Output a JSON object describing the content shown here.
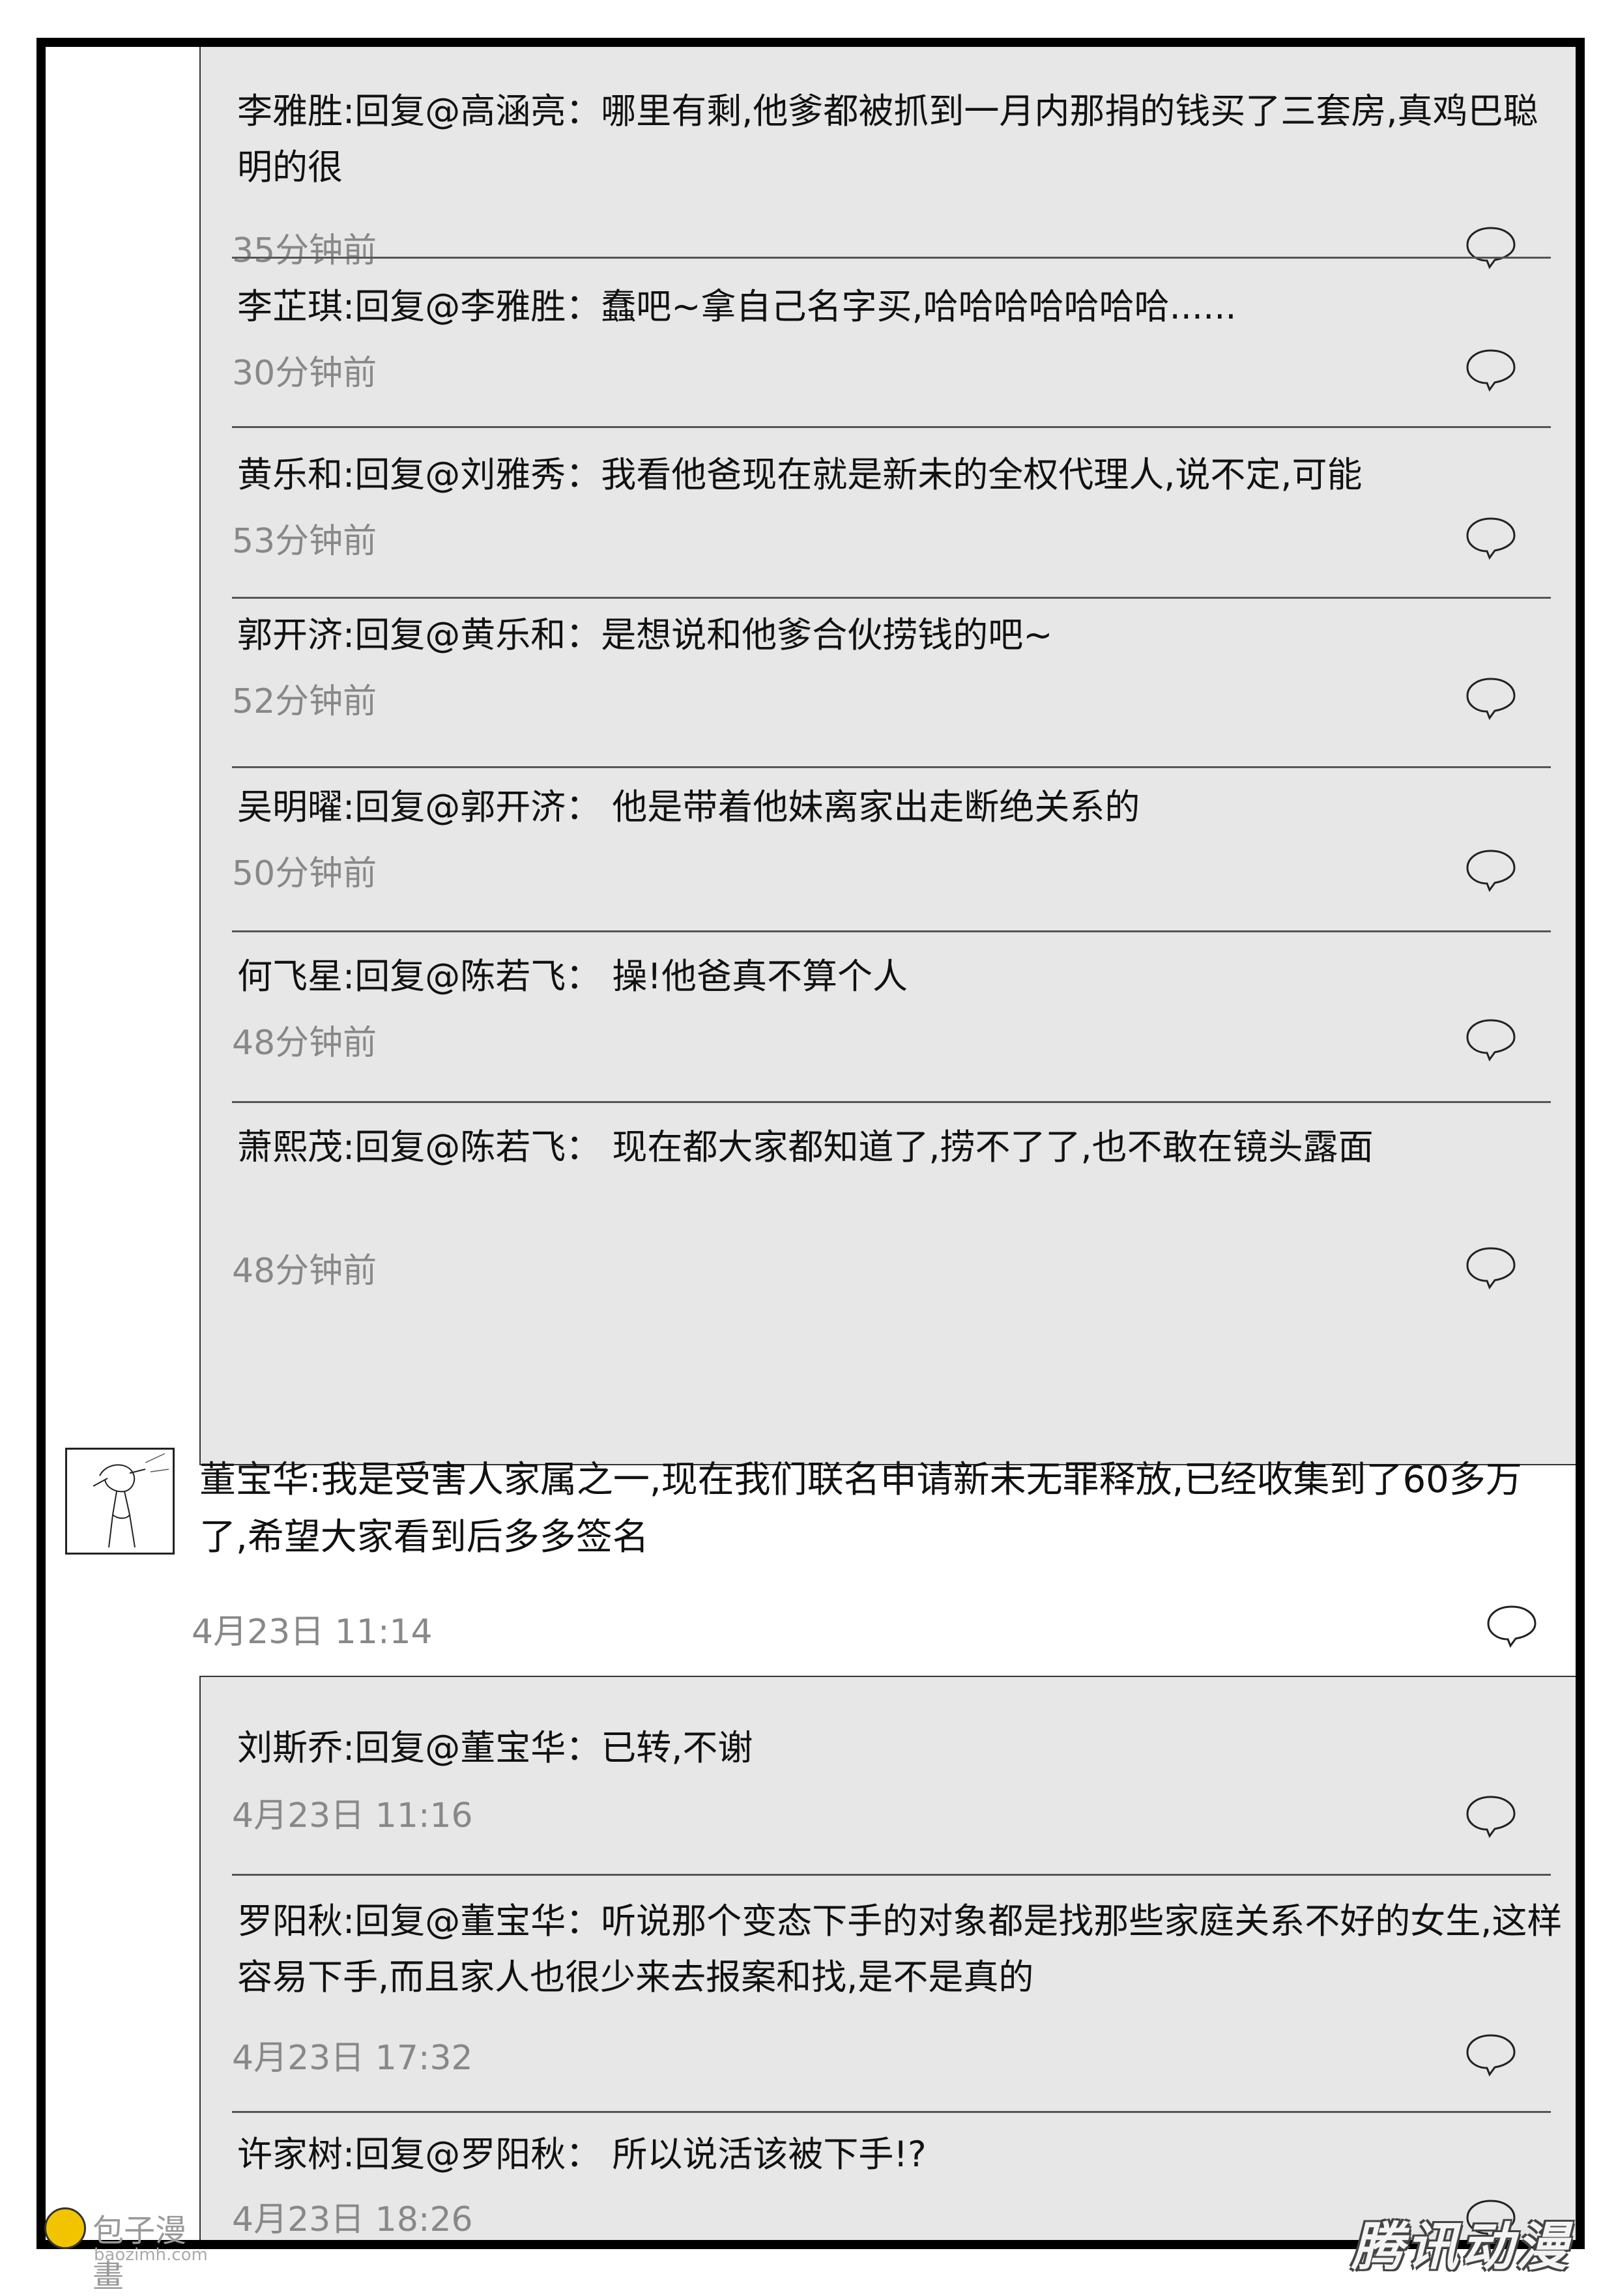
{
  "thread1": [
    {
      "name": "李雅胜",
      "text": "李雅胜:回复@高涵亮：哪里有剩,他爹都被抓到一月内那捐的钱买了三套房,真鸡巴聪明的很",
      "time": "35分钟前"
    },
    {
      "name": "李芷琪",
      "text": "李芷琪:回复@李雅胜：蠢吧~拿自己名字买,哈哈哈哈哈哈哈......",
      "time": "30分钟前"
    },
    {
      "name": "黄乐和",
      "text": "黄乐和:回复@刘雅秀：我看他爸现在就是新未的全权代理人,说不定,可能",
      "time": "53分钟前"
    },
    {
      "name": "郭开济",
      "text": "郭开济:回复@黄乐和：是想说和他爹合伙捞钱的吧~",
      "time": "52分钟前"
    },
    {
      "name": "吴明曜",
      "text": "吴明曜:回复@郭开济： 他是带着他妹离家出走断绝关系的",
      "time": "50分钟前"
    },
    {
      "name": "何飞星",
      "text": "何飞星:回复@陈若飞： 操!他爸真不算个人",
      "time": "48分钟前"
    },
    {
      "name": "萧熙茂",
      "text": "萧熙茂:回复@陈若飞： 现在都大家都知道了,捞不了了,也不敢在镜头露面",
      "time": "48分钟前"
    }
  ],
  "comment": {
    "text": "董宝华:我是受害人家属之一,现在我们联名申请新未无罪释放,已经收集到了60多万了,希望大家看到后多多签名",
    "time": "4月23日 11:14"
  },
  "thread2": [
    {
      "text": "刘斯乔:回复@董宝华：已转,不谢",
      "time": "4月23日 11:16"
    },
    {
      "text": "罗阳秋:回复@董宝华：听说那个变态下手的对象都是找那些家庭关系不好的女生,这样容易下手,而且家人也很少来去报案和找,是不是真的",
      "time": "4月23日 17:32"
    },
    {
      "text": "许家树:回复@罗阳秋： 所以说活该被下手!?",
      "time": "4月23日 18:26"
    }
  ],
  "watermark": {
    "left_title": "包子漫畫",
    "left_url": "baozimh.com",
    "right_text": "腾讯动漫"
  }
}
